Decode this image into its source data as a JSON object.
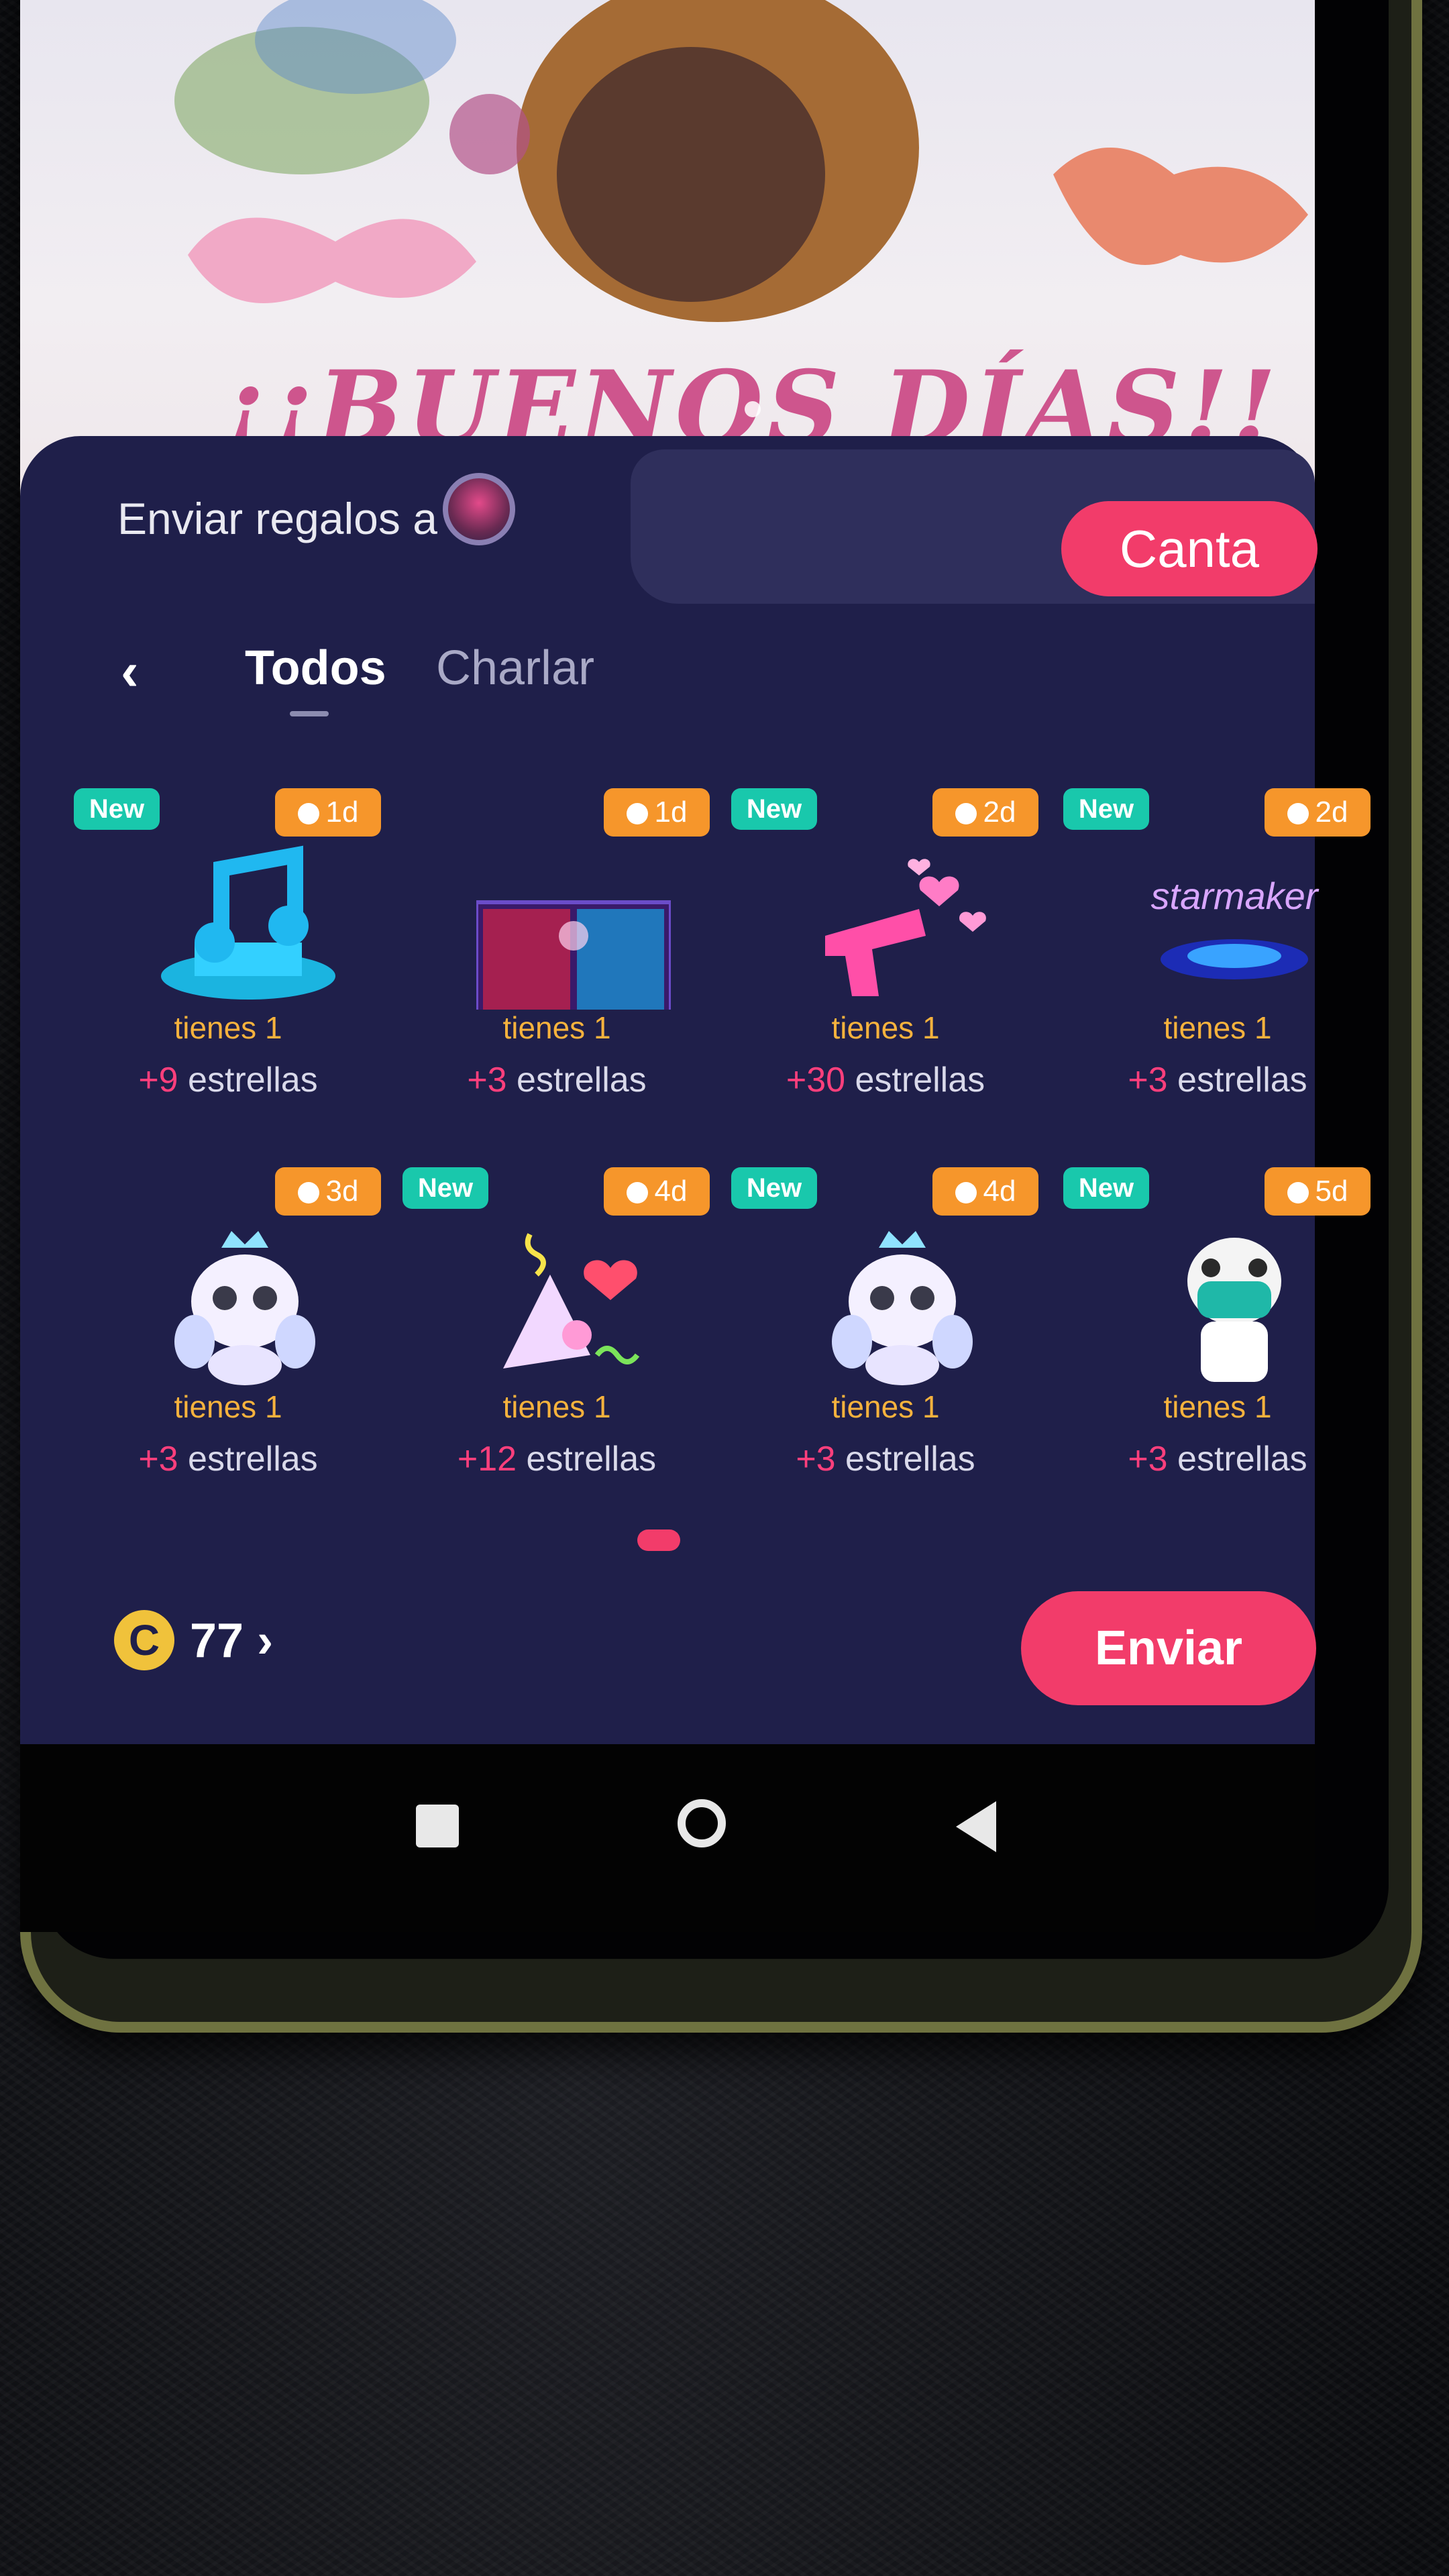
{
  "wallpaper": {
    "title": "¡¡BUENOS DÍAS!!"
  },
  "header": {
    "send_to_label": "Enviar regalos a",
    "canta_label": "Canta"
  },
  "tabs": {
    "back_icon": "‹",
    "items": [
      {
        "label": "Todos",
        "active": true
      },
      {
        "label": "Charlar",
        "active": false
      }
    ]
  },
  "gifts": [
    {
      "new": "New",
      "days": "1d",
      "have": "tienes 1",
      "plus": "+9",
      "stars": " estrellas",
      "icon": "music-note-gift"
    },
    {
      "new": "",
      "days": "1d",
      "have": "tienes 1",
      "plus": "+3",
      "stars": " estrellas",
      "icon": "stage-gift"
    },
    {
      "new": "New",
      "days": "2d",
      "have": "tienes 1",
      "plus": "+30",
      "stars": " estrellas",
      "icon": "heart-gun-gift"
    },
    {
      "new": "New",
      "days": "2d",
      "have": "tienes 1",
      "plus": "+3",
      "stars": " estrellas",
      "icon": "starmaker-gift",
      "logo_text": "starmaker"
    },
    {
      "new": "",
      "days": "3d",
      "have": "tienes 1",
      "plus": "+3",
      "stars": " estrellas",
      "icon": "panda-angel-gift"
    },
    {
      "new": "New",
      "days": "4d",
      "have": "tienes 1",
      "plus": "+12",
      "stars": " estrellas",
      "icon": "party-gift"
    },
    {
      "new": "New",
      "days": "4d",
      "have": "tienes 1",
      "plus": "+3",
      "stars": " estrellas",
      "icon": "panda-angel-gift"
    },
    {
      "new": "New",
      "days": "5d",
      "have": "tienes 1",
      "plus": "+3",
      "stars": " estrellas",
      "icon": "panda-doctor-gift"
    }
  ],
  "footer": {
    "coin_symbol": "C",
    "coin_count": "77 ›",
    "send_label": "Enviar"
  },
  "colors": {
    "accent": "#f23c6a",
    "panel": "#1f1f4a",
    "badge_new": "#19c8ac",
    "badge_days": "#f6962b",
    "have_text": "#f6b23d"
  }
}
